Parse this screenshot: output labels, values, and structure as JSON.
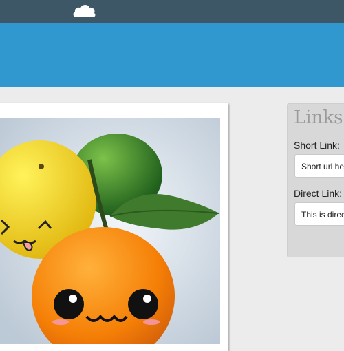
{
  "header": {
    "logo_icon": "cloud-icon"
  },
  "links": {
    "title": "Links",
    "short_label": "Short Link:",
    "short_value": "Short url he",
    "direct_label": "Direct Link:",
    "direct_value": "This is direc"
  },
  "photo": {
    "icon": "fruit-photo"
  },
  "colors": {
    "topbar": "#3d5766",
    "banner": "#3097cf",
    "page_background": "#ececec",
    "panel_background": "#d8d8d8"
  }
}
